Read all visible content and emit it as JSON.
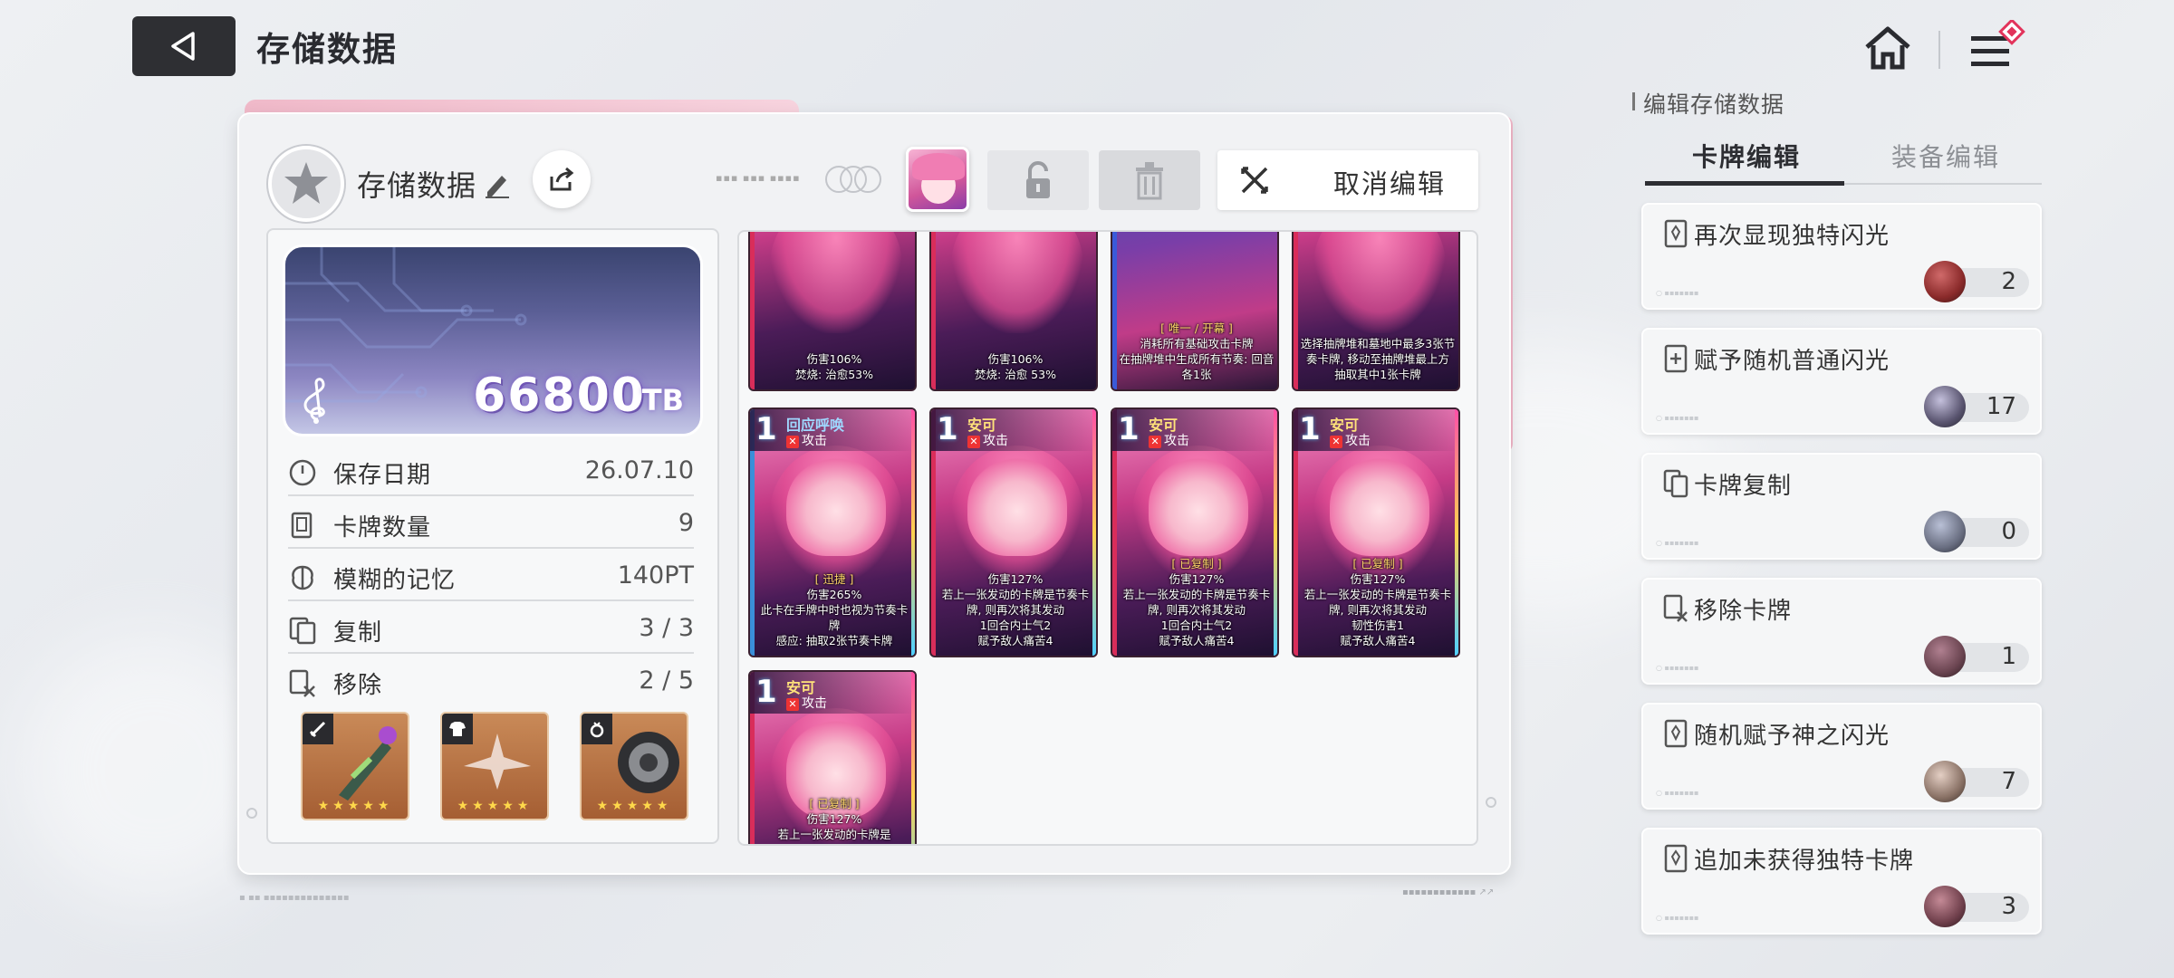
{
  "header": {
    "title": "存储数据"
  },
  "save": {
    "name": "存储数据",
    "tb_value": "66800",
    "tb_unit": "TB",
    "cancel_label": "取消编辑"
  },
  "stats": [
    {
      "label": "保存日期",
      "value": "26.07.10",
      "icon": "clock-icon"
    },
    {
      "label": "卡牌数量",
      "value": "9",
      "icon": "card-count-icon"
    },
    {
      "label": "模糊的记忆",
      "value": "140PT",
      "icon": "brain-icon"
    },
    {
      "label": "复制",
      "value": "3 / 3",
      "icon": "copy-card-icon"
    },
    {
      "label": "移除",
      "value": "2 / 5",
      "icon": "remove-card-icon"
    }
  ],
  "equipment": [
    {
      "slot": "weapon",
      "icon": "sword-icon",
      "stars": "★★★★★"
    },
    {
      "slot": "armor",
      "icon": "armor-icon",
      "stars": "★★★★★"
    },
    {
      "slot": "ring",
      "icon": "ring-icon",
      "stars": "★★★★★"
    }
  ],
  "cards": [
    {
      "desc1": "伤害106%",
      "desc2": "焚烧: 治愈53%"
    },
    {
      "desc1": "伤害106%",
      "desc2": "焚烧: 治愈 53%"
    },
    {
      "sub": "[ 唯一 / 开幕 ]",
      "desc1": "消耗所有基础攻击卡牌",
      "desc2": "在抽牌堆中生成所有节奏: 回音各1张"
    },
    {
      "desc1": "选择抽牌堆和墓地中最多3张节奏卡牌, 移动至抽牌堆最上方",
      "desc2": "抽取其中1张卡牌"
    },
    {
      "cost": "1",
      "name": "回应呼唤",
      "type": "攻击",
      "sub": "[ 迅捷 ]",
      "desc1": "伤害265%",
      "desc2": "此卡在手牌中时也视为节奏卡牌",
      "desc3": "感应: 抽取2张节奏卡牌"
    },
    {
      "cost": "1",
      "name": "安可",
      "type": "攻击",
      "desc1": "伤害127%",
      "desc2": "若上一张发动的卡牌是节奏卡牌, 则再次将其发动",
      "desc3": "1回合内士气2",
      "desc4": "赋予敌人痛苦4"
    },
    {
      "cost": "1",
      "name": "安可",
      "type": "攻击",
      "sub": "[ 已复制 ]",
      "desc1": "伤害127%",
      "desc2": "若上一张发动的卡牌是节奏卡牌, 则再次将其发动",
      "desc3": "1回合内士气2",
      "desc4": "赋予敌人痛苦4"
    },
    {
      "cost": "1",
      "name": "安可",
      "type": "攻击",
      "sub": "[ 已复制 ]",
      "desc1": "伤害127%",
      "desc2": "若上一张发动的卡牌是节奏卡牌, 则再次将其发动",
      "desc3": "韧性伤害1",
      "desc4": "赋予敌人痛苦4"
    },
    {
      "cost": "1",
      "name": "安可",
      "type": "攻击",
      "sub": "[ 已复制 ]",
      "desc1": "伤害127%",
      "desc2": "若上一张发动的卡牌是"
    }
  ],
  "right_panel": {
    "title": "编辑存储数据",
    "tabs": [
      "卡牌编辑",
      "装备编辑"
    ],
    "options": [
      {
        "label": "再次显现独特闪光",
        "count": "2",
        "color": "#8a2a2a"
      },
      {
        "label": "赋予随机普通闪光",
        "count": "17",
        "color": "#5a5570"
      },
      {
        "label": "卡牌复制",
        "count": "0",
        "color": "#6a6f82"
      },
      {
        "label": "移除卡牌",
        "count": "1",
        "color": "#6a4450"
      },
      {
        "label": "随机赋予神之闪光",
        "count": "7",
        "color": "#8a7266"
      },
      {
        "label": "追加未获得独特卡牌",
        "count": "3",
        "color": "#70404c"
      }
    ]
  }
}
